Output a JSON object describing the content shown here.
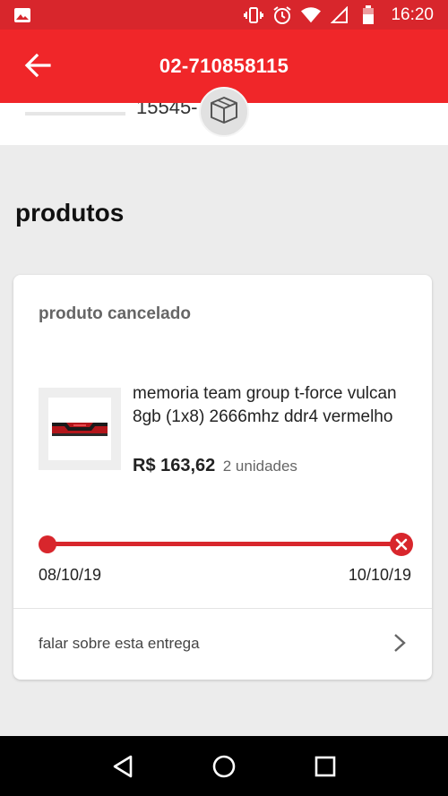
{
  "status_bar": {
    "time": "16:20",
    "icons": [
      "image-icon",
      "vibrate-icon",
      "alarm-icon",
      "wifi-icon",
      "signal-icon",
      "battery-icon"
    ]
  },
  "app_bar": {
    "title": "02-710858115",
    "back_icon": "back-arrow-icon"
  },
  "top_strip": {
    "partial_text": "15545-"
  },
  "badge_icon": "package-box-icon",
  "section": {
    "title": "produtos"
  },
  "card": {
    "status": "produto cancelado",
    "product": {
      "name": "memoria team group t-force vulcan 8gb (1x8) 2666mhz ddr4 vermelho",
      "price": "R$ 163,62",
      "units": "2 unidades"
    },
    "timeline": {
      "start_date": "08/10/19",
      "end_date": "10/10/19"
    },
    "talk_label": "falar sobre esta entrega"
  },
  "colors": {
    "brand_red": "#f02629",
    "status_red": "#d8262c",
    "background": "#ececec"
  },
  "nav_bar": {
    "icons": [
      "nav-back-icon",
      "nav-home-icon",
      "nav-recents-icon"
    ]
  }
}
